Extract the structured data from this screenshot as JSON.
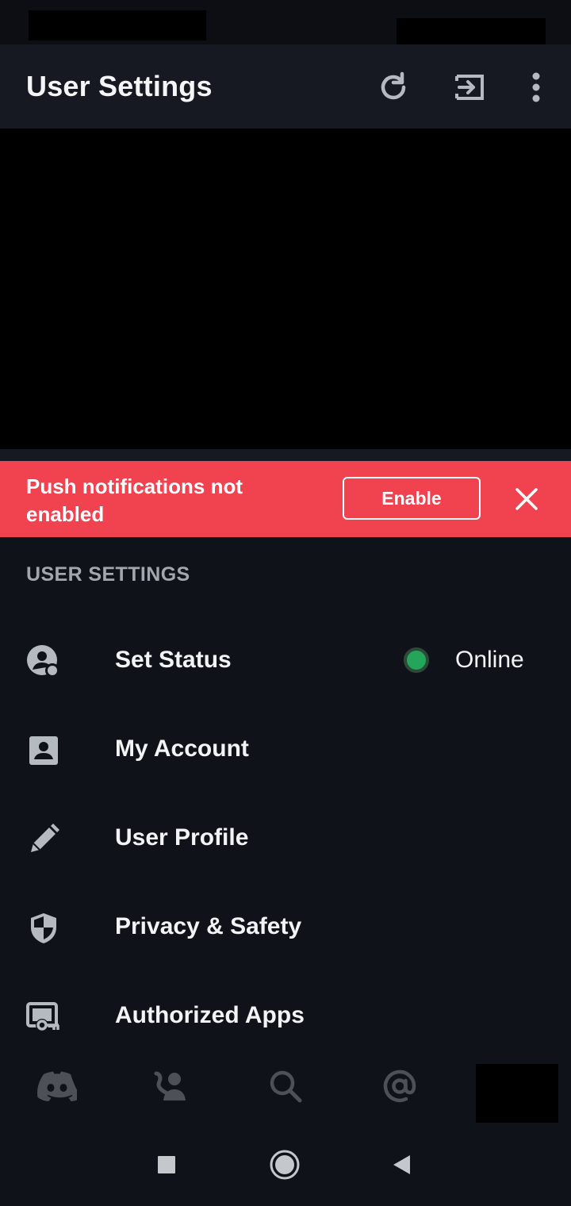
{
  "app_bar": {
    "title": "User Settings",
    "actions": [
      {
        "icon": "refresh-icon"
      },
      {
        "icon": "logout-icon"
      },
      {
        "icon": "more-vertical-icon"
      }
    ]
  },
  "push_notice": {
    "message": "Push notifications not enabled",
    "enable_label": "Enable",
    "close_icon": "close-icon",
    "background": "#f0434f"
  },
  "settings": {
    "section_title": "USER SETTINGS",
    "items": [
      {
        "label": "Set Status",
        "icon": "user-status-icon",
        "value": "Online",
        "status_color": "#23a55a"
      },
      {
        "label": "My Account",
        "icon": "account-card-icon"
      },
      {
        "label": "User Profile",
        "icon": "pencil-icon"
      },
      {
        "label": "Privacy & Safety",
        "icon": "shield-icon"
      },
      {
        "label": "Authorized Apps",
        "icon": "app-key-icon"
      }
    ]
  },
  "bottom_nav": [
    {
      "icon": "discord-home-icon"
    },
    {
      "icon": "friends-icon"
    },
    {
      "icon": "search-icon"
    },
    {
      "icon": "mentions-icon"
    }
  ],
  "system_nav": [
    {
      "icon": "recents-square-icon"
    },
    {
      "icon": "home-circle-icon"
    },
    {
      "icon": "back-triangle-icon"
    }
  ],
  "colors": {
    "background": "#10121a",
    "app_bar": "#161922",
    "text_primary": "#f2f3f5",
    "text_muted": "#a3a6ad",
    "icon": "#b5bac1",
    "online": "#23a55a"
  }
}
